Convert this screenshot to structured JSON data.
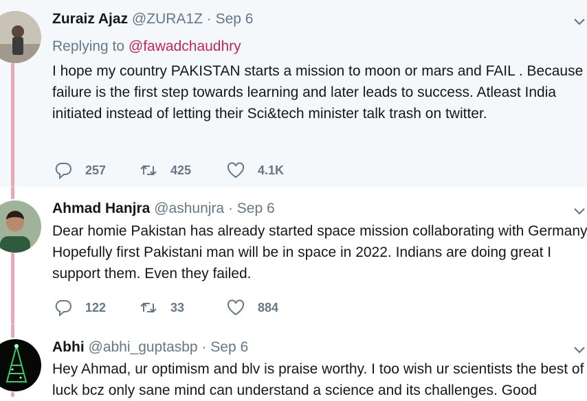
{
  "tweets": [
    {
      "name": "Zuraiz Ajaz",
      "handle": "@ZURA1Z",
      "date": "· Sep 6",
      "replying_prefix": "Replying to ",
      "replying_to": "@fawadchaudhry",
      "text": "I hope my country PAKISTAN starts a mission to moon or mars and FAIL . Because failure is the first step towards learning and later leads to success. Atleast India initiated instead of letting their Sci&tech minister talk trash on twitter.",
      "replies": "257",
      "retweets": "425",
      "likes": "4.1K"
    },
    {
      "name": "Ahmad Hanjra",
      "handle": "@ashunjra",
      "date": "· Sep 6",
      "text": "Dear homie Pakistan has already started space mission collaborating with Germany. Hopefully first Pakistani man will be in space in 2022. Indians are doing great I support them. Even they failed.",
      "replies": "122",
      "retweets": "33",
      "likes": "884"
    },
    {
      "name": "Abhi",
      "handle": "@abhi_guptasbp",
      "date": "· Sep 6",
      "text": "Hey Ahmad, ur optimism and blv is praise worthy. I too wish ur scientists the best of luck bcz only sane mind can understand a science and its challenges. Good"
    }
  ],
  "icons": {
    "reply": "reply-icon",
    "retweet": "retweet-icon",
    "like": "heart-icon",
    "more": "chevron-down-icon"
  },
  "colors": {
    "thread_line": "#e9a6b5",
    "mention": "#c2255c",
    "muted": "#657786",
    "highlight_bg": "#f5f8fa"
  }
}
